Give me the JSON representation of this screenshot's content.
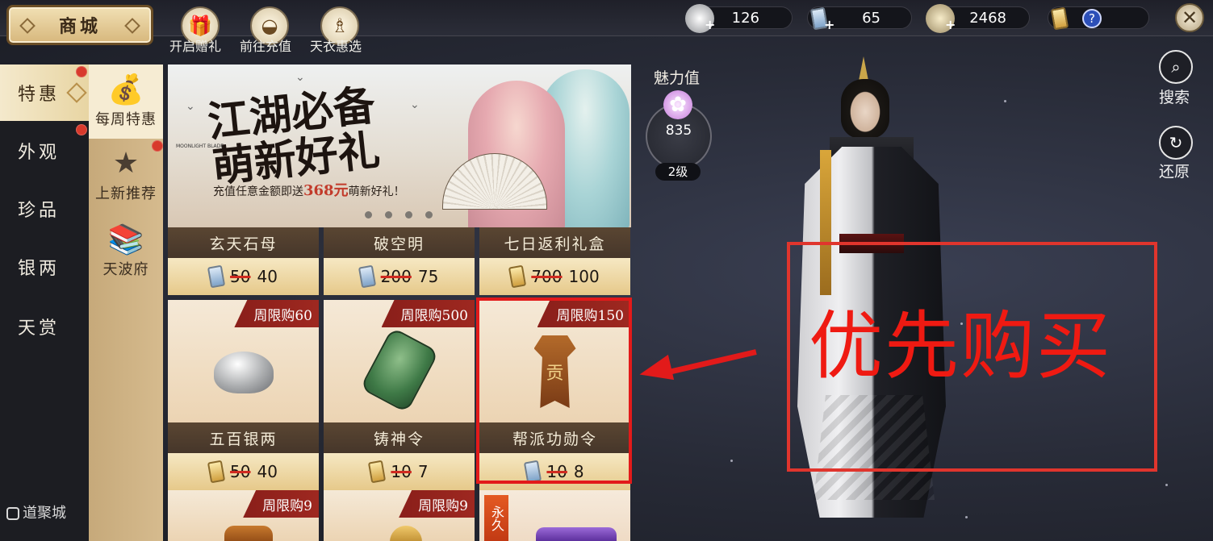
{
  "header": {
    "title": "商城",
    "actions": [
      {
        "label": "开启赠礼",
        "icon": "gift-icon"
      },
      {
        "label": "前往充值",
        "icon": "gold-ingot-icon"
      },
      {
        "label": "天衣惠选",
        "icon": "robe-icon"
      }
    ],
    "currencies": [
      {
        "icon": "silver-currency-icon",
        "value": "126"
      },
      {
        "icon": "blue-ticket-icon",
        "value": "65"
      },
      {
        "icon": "coin-pouch-icon",
        "value": "2468"
      },
      {
        "icon": "gold-ticket-icon",
        "value": "?"
      }
    ]
  },
  "left_menu": {
    "items": [
      {
        "label": "特惠",
        "active": true,
        "badge": true
      },
      {
        "label": "外观",
        "active": false,
        "badge": true
      },
      {
        "label": "珍品",
        "active": false,
        "badge": false
      },
      {
        "label": "银两",
        "active": false,
        "badge": false
      },
      {
        "label": "天赏",
        "active": false,
        "badge": false
      }
    ]
  },
  "sub_menu": {
    "items": [
      {
        "label": "每周特惠",
        "icon": "moneybag-icon",
        "active": true
      },
      {
        "label": "上新推荐",
        "icon": "star-wreath-icon",
        "active": false,
        "badge": true
      },
      {
        "label": "天波府",
        "icon": "book-stack-icon",
        "active": false
      }
    ]
  },
  "banner": {
    "title": "江湖必备 萌新好礼",
    "subtitle_pre": "充值任意金额即送",
    "subtitle_amount": "368元",
    "subtitle_post": "萌新好礼！",
    "brand": "MOONLIGHT BLADE"
  },
  "items_row1": [
    {
      "name": "玄天石母",
      "old_price": "50",
      "price": "40",
      "currency": "blue"
    },
    {
      "name": "破空明",
      "old_price": "200",
      "price": "75",
      "currency": "blue"
    },
    {
      "name": "七日返利礼盒",
      "old_price": "700",
      "price": "100",
      "currency": "gold"
    }
  ],
  "items_row2": [
    {
      "name": "五百银两",
      "limit": "周限购60",
      "old_price": "50",
      "price": "40",
      "currency": "gold"
    },
    {
      "name": "铸神令",
      "limit": "周限购500",
      "old_price": "10",
      "price": "7",
      "currency": "gold"
    },
    {
      "name": "帮派功勋令",
      "limit": "周限购150",
      "old_price": "10",
      "price": "8",
      "currency": "blue",
      "token_char": "贡"
    }
  ],
  "items_row3": [
    {
      "limit": "周限购9"
    },
    {
      "limit": "周限购9"
    },
    {
      "tag": "永久"
    }
  ],
  "charm": {
    "label": "魅力值",
    "value": "835",
    "level": "2级"
  },
  "side_actions": [
    {
      "label": "搜索",
      "icon": "magnifier-icon"
    },
    {
      "label": "还原",
      "icon": "refresh-icon"
    }
  ],
  "annotation": {
    "text": "优先购买",
    "color": "#e21a1a"
  },
  "logo": "道聚城",
  "colors": {
    "accent_red": "#e21a1a",
    "tag_red": "#8a1f1a",
    "card_gold": "#e6c98a"
  }
}
